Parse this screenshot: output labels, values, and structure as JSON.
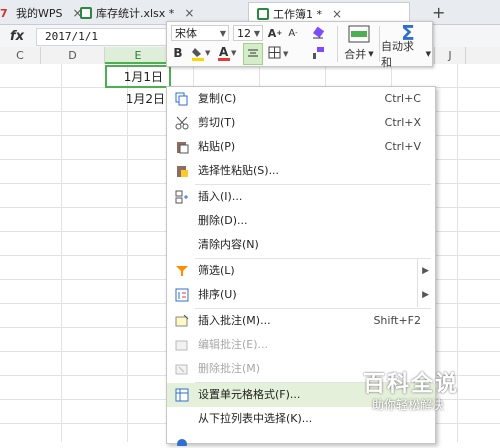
{
  "tabs": [
    {
      "label": "我的WPS",
      "close": "×"
    },
    {
      "label": "库存统计.xlsx *",
      "close": "×"
    },
    {
      "label": "工作簿1 *",
      "close": "×"
    }
  ],
  "add_tab": "+",
  "formula_bar": {
    "fx": "fx",
    "value": "2017/1/1"
  },
  "columns": [
    "C",
    "D",
    "E",
    "",
    "J"
  ],
  "cells": {
    "e1": "1月1日",
    "e2": "1月2日"
  },
  "mini_toolbar": {
    "font_name": "宋体",
    "font_size": "12",
    "merge_label": "合并",
    "autosum_label": "自动求和"
  },
  "context_menu": {
    "copy": {
      "label": "复制(C)",
      "shortcut": "Ctrl+C"
    },
    "cut": {
      "label": "剪切(T)",
      "shortcut": "Ctrl+X"
    },
    "paste": {
      "label": "粘贴(P)",
      "shortcut": "Ctrl+V"
    },
    "paste_special": {
      "label": "选择性粘贴(S)..."
    },
    "insert": {
      "label": "插入(I)..."
    },
    "delete": {
      "label": "删除(D)..."
    },
    "clear": {
      "label": "清除内容(N)"
    },
    "filter": {
      "label": "筛选(L)"
    },
    "sort": {
      "label": "排序(U)"
    },
    "insert_comment": {
      "label": "插入批注(M)...",
      "shortcut": "Shift+F2"
    },
    "edit_comment": {
      "label": "编辑批注(E)..."
    },
    "delete_comment": {
      "label": "删除批注(M)"
    },
    "format_cells": {
      "label": "设置单元格格式(F)..."
    },
    "pick_from_list": {
      "label": "从下拉列表中选择(K)..."
    }
  },
  "watermark": {
    "title": "百科全说",
    "subtitle": "助你轻松解决"
  },
  "colors": {
    "accent_green": "#4caf50",
    "highlight": "#e4f0d9",
    "blue": "#2f6fd1"
  }
}
